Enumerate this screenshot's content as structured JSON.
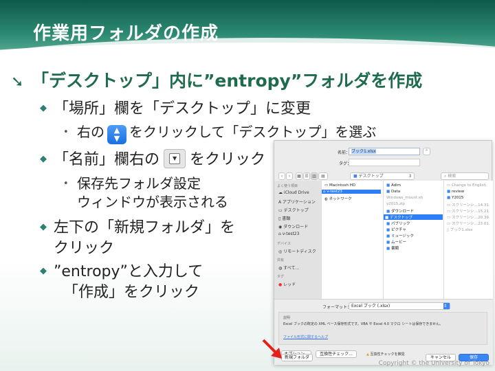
{
  "slide": {
    "title": "作業用フォルダの作成",
    "main_bullet": "「デスクトップ」内に”entropy”フォルダを作成",
    "bullets": {
      "b1": "「場所」欄を「デスクトップ」に変更",
      "b1_sub_pre": "右の",
      "b1_sub_post": "をクリックして「デスクトップ」を選ぶ",
      "b2_pre": "「名前」欄右の",
      "b2_post": "をクリック",
      "b2_sub_line1": "保存先フォルダ設定",
      "b2_sub_line2": "ウィンドウが表示される",
      "b3_line1": "左下の「新規フォルダ」を",
      "b3_line2": "クリック",
      "b4_line1": "”entropy”と入力して",
      "b4_line2": "「作成」をクリック"
    },
    "copyright": "Copyright © the University of Tokyo",
    "accent_color": "#1f6b4d",
    "title_bar_color": "#0e5a4a"
  },
  "dialog": {
    "name_label": "名前：",
    "name_value": "ブック1.xlsx",
    "tag_label": "タグ：",
    "location_value": "デスクトップ",
    "search_placeholder": "検索",
    "sidebar": {
      "favorites_head": "よく使う項目",
      "items": [
        "iCloud Drive",
        "アプリケーション",
        "デスクトップ",
        "書類",
        "ダウンロード",
        "v-test23"
      ],
      "devices_head": "デバイス",
      "remote_disc": "リモートディスク",
      "shared_head": "共有",
      "all": "すべて...",
      "tags_head": "タグ",
      "red": "レッド"
    },
    "col1": [
      "Macintosh HD",
      "v-test23",
      "ネットワーク"
    ],
    "col2": [
      "Adlm",
      "Data",
      "Windows_mount.sh",
      "y2015.zip",
      "ダウンロード",
      "デスクトップ",
      "パブリック",
      "ピクチャ",
      "ミュージック",
      "ムービー",
      "書類"
    ],
    "col3": [
      "Change to English",
      "review",
      "Y2015",
      "スクリーンシ…14.31.",
      "スクリーンシ…15.21.",
      "スクリーンシ…20.39.",
      "スクリーンシ…23.01.",
      "ブック1.xlsx"
    ],
    "format_label": "フォーマット：",
    "format_value": "Excel ブック (.xlsx)",
    "desc_head": "説明",
    "desc_text": "Excel ブックの既定の XML ベース保存形式です。VBA や Excel 4.0 マクロ シートは保存できません。",
    "link_text": "ファイル形式に関するヘルプ",
    "options_button": "オプション...",
    "compat_button": "互換性チェック...",
    "compat_warning": "互換性チェックを推奨",
    "new_folder_button": "新規フォルダ",
    "cancel_button": "キャンセル",
    "save_button": "保存"
  }
}
